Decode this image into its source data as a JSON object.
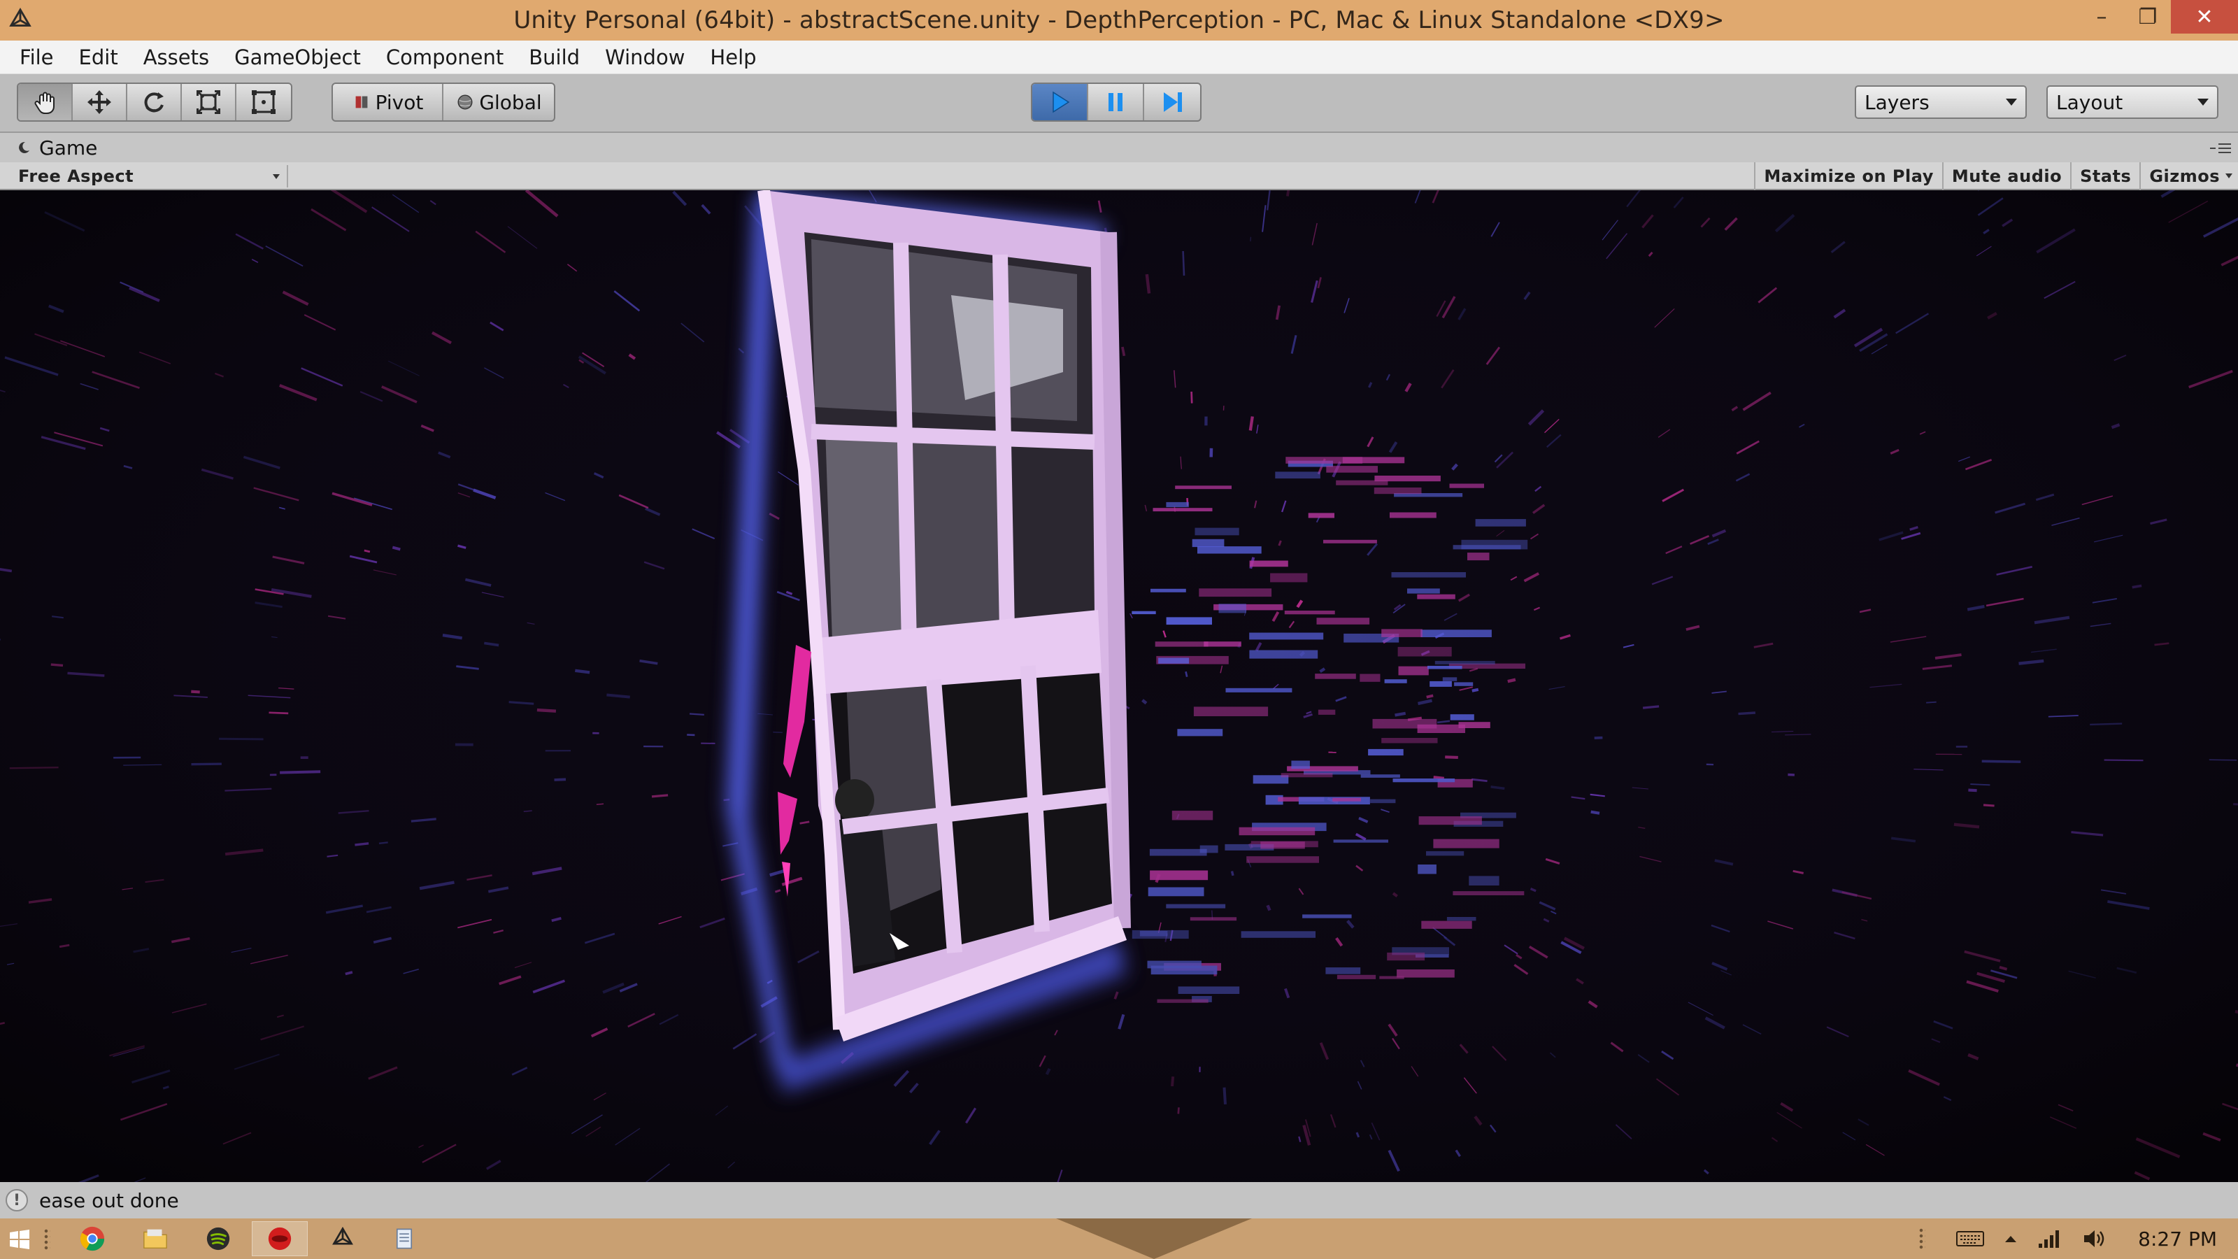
{
  "window": {
    "title": "Unity Personal (64bit) - abstractScene.unity - DepthPerception - PC, Mac & Linux Standalone <DX9>",
    "controls": [
      "minimize-icon",
      "restore-icon",
      "close-icon"
    ]
  },
  "menu": {
    "items": [
      "File",
      "Edit",
      "Assets",
      "GameObject",
      "Component",
      "Build",
      "Window",
      "Help"
    ]
  },
  "toolbar": {
    "tools": [
      "hand-icon",
      "move-icon",
      "rotate-icon",
      "scale-icon",
      "rect-icon"
    ],
    "active_tool": "hand-icon",
    "pivot_label": "Pivot",
    "global_label": "Global",
    "playback": [
      "play-icon",
      "pause-icon",
      "step-icon"
    ],
    "layers_label": "Layers",
    "layout_label": "Layout"
  },
  "game_panel": {
    "tab_title": "Game",
    "aspect": "Free Aspect",
    "maximize_label": "Maximize on Play",
    "mute_label": "Mute audio",
    "stats_label": "Stats",
    "gizmos_label": "Gizmos"
  },
  "status": {
    "icon": "info-icon",
    "message": "ease out done"
  },
  "taskbar": {
    "apps": [
      "chrome-icon",
      "file-explorer-icon",
      "spotify-icon",
      "red-app-icon",
      "unity-icon",
      "document-icon"
    ],
    "active_app": "red-app-icon",
    "tray_icons": [
      "keyboard-icon",
      "chevron-up-icon",
      "signal-icon",
      "speaker-icon"
    ],
    "clock": "8:27 PM"
  },
  "colors": {
    "title_bar": "#e0a96f",
    "close_button": "#c7503f",
    "play_active": "#4a76b8",
    "viewport_bg": "#0b0710",
    "streak_magenta": "#d0309a",
    "streak_blue": "#5a4fd6",
    "window_frame": "#e6c2ee"
  }
}
